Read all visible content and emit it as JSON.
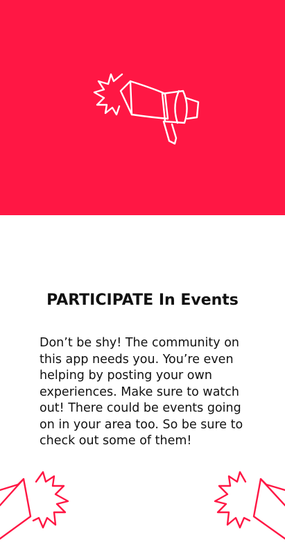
{
  "hero": {
    "background": "#ff1744",
    "icon": "megaphone-icon"
  },
  "title": "PARTICIPATE In Events",
  "body": "Don’t be shy! The community on this app needs you. You’re even helping by posting your own experiences. Make sure to watch out! There could be events going on in your area too. So be sure to check out some of them!",
  "accent": "#ff1744",
  "decorations": {
    "bottom_left": "megaphone-icon",
    "bottom_right": "megaphone-icon"
  }
}
